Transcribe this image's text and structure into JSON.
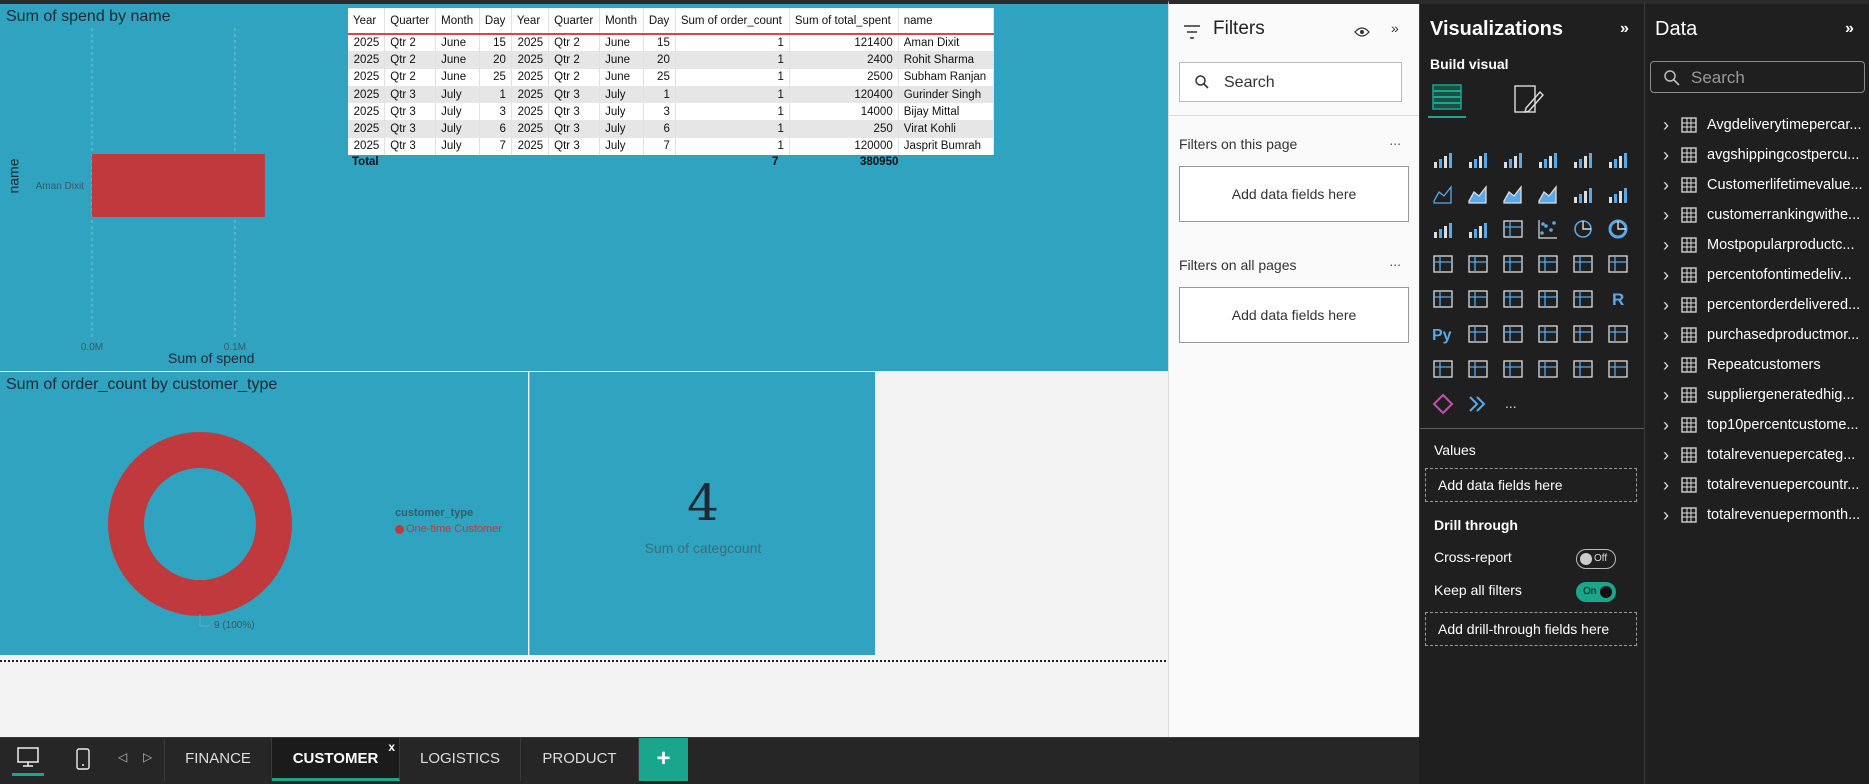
{
  "canvas": {
    "spend_chart": {
      "title": "Sum of spend by name",
      "chart_data": {
        "type": "bar",
        "orientation": "horizontal",
        "categories": [
          "Aman Dixit"
        ],
        "values": [
          0.121
        ],
        "xlabel": "Sum of spend",
        "ylabel": "name",
        "xticks": [
          "0.0M",
          "0.1M"
        ],
        "xlim": [
          0,
          0.14
        ],
        "bar_color": "#c0393c"
      }
    },
    "table": {
      "headers": [
        "Year",
        "Quarter",
        "Month",
        "Day",
        "Year",
        "Quarter",
        "Month",
        "Day",
        "Sum of order_count",
        "Sum of total_spent",
        "name"
      ],
      "rows": [
        [
          "2025",
          "Qtr 2",
          "June",
          "15",
          "2025",
          "Qtr 2",
          "June",
          "15",
          "1",
          "121400",
          "Aman Dixit"
        ],
        [
          "2025",
          "Qtr 2",
          "June",
          "20",
          "2025",
          "Qtr 2",
          "June",
          "20",
          "1",
          "2400",
          "Rohit Sharma"
        ],
        [
          "2025",
          "Qtr 2",
          "June",
          "25",
          "2025",
          "Qtr 2",
          "June",
          "25",
          "1",
          "2500",
          "Subham Ranjan"
        ],
        [
          "2025",
          "Qtr 3",
          "July",
          "1",
          "2025",
          "Qtr 3",
          "July",
          "1",
          "1",
          "120400",
          "Gurinder Singh"
        ],
        [
          "2025",
          "Qtr 3",
          "July",
          "3",
          "2025",
          "Qtr 3",
          "July",
          "3",
          "1",
          "14000",
          "Bijay Mittal"
        ],
        [
          "2025",
          "Qtr 3",
          "July",
          "6",
          "2025",
          "Qtr 3",
          "July",
          "6",
          "1",
          "250",
          "Virat Kohli"
        ],
        [
          "2025",
          "Qtr 3",
          "July",
          "7",
          "2025",
          "Qtr 3",
          "July",
          "7",
          "1",
          "120000",
          "Jasprit Bumrah"
        ]
      ],
      "total_label": "Total",
      "total_order_count": "7",
      "total_spent": "380950"
    },
    "donut_chart": {
      "title": "Sum of order_count by customer_type",
      "legend_title": "customer_type",
      "data_label": "9 (100%)",
      "chart_data": {
        "type": "pie",
        "variant": "donut",
        "categories": [
          "One-time Customer"
        ],
        "values": [
          9
        ],
        "colors": [
          "#c0393c"
        ],
        "legend_placement": "right"
      }
    },
    "card": {
      "value": "4",
      "label": "Sum of categcount"
    }
  },
  "filters": {
    "title": "Filters",
    "search_placeholder": "Search",
    "on_this_page": "Filters on this page",
    "on_all_pages": "Filters on all pages",
    "add_fields": "Add data fields here",
    "more": "..."
  },
  "visualizations": {
    "title": "Visualizations",
    "build_visual": "Build visual",
    "more": "...",
    "values_label": "Values",
    "values_well": "Add data fields here",
    "drill_through": "Drill through",
    "cross_report": "Cross-report",
    "cross_report_state": "Off",
    "keep_filters": "Keep all filters",
    "keep_filters_state": "On",
    "drill_well": "Add drill-through fields here",
    "accent": "#19a68d"
  },
  "data_pane": {
    "title": "Data",
    "search_placeholder": "Search",
    "tables": [
      "Avgdeliverytimepercar...",
      "avgshippingcostpercu...",
      "Customerlifetimevalue...",
      "customerrankingwithe...",
      "Mostpopularproductc...",
      "percentofontimedeliv...",
      "percentorderdelivered...",
      "purchasedproductmor...",
      "Repeatcustomers",
      "suppliergeneratedhig...",
      "top10percentcustome...",
      "totalrevenuepercateg...",
      "totalrevenuepercountr...",
      "totalrevenuepermonth..."
    ]
  },
  "bottom": {
    "tabs": [
      "FINANCE",
      "CUSTOMER",
      "LOGISTICS",
      "PRODUCT"
    ],
    "active_tab": "CUSTOMER",
    "close": "x",
    "add": "+"
  }
}
